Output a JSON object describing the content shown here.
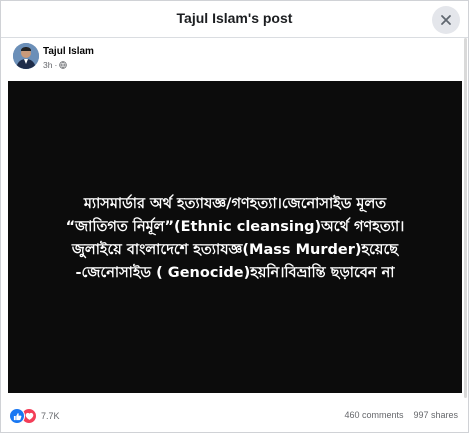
{
  "header": {
    "title": "Tajul Islam's post",
    "close_icon": "close-icon"
  },
  "author": {
    "name": "Tajul Islam",
    "time": "3h",
    "separator": "·",
    "audience_icon": "globe-icon"
  },
  "post_image": {
    "background": "#0c0c0c",
    "lines": [
      "ম্যাসমার্ডার অর্থ হত্যাযজ্ঞ/গণহত্যা।জেনোসাইড মূলত",
      "“জাতিগত নির্মূল”(Ethnic cleansing)অর্থে গণহত্যা।",
      "জুলাইয়ে বাংলাদেশে হত্যাযজ্ঞ(Mass Murder)হয়েছে",
      "-জেনোসাইড ( Genocide)হয়নি।বিভ্রান্তি ছড়াবেন না"
    ]
  },
  "footer": {
    "reaction_count": "7.7K",
    "comments": "460 comments",
    "shares": "997 shares"
  },
  "colors": {
    "accent": "#1877f2",
    "love": "#f33e58"
  }
}
